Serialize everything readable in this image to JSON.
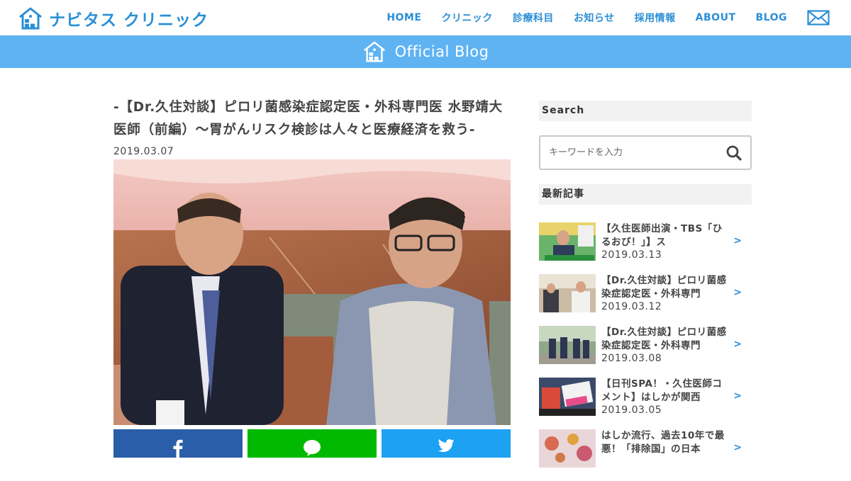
{
  "header": {
    "logo_text": "ナビタス クリニック",
    "nav": [
      "HOME",
      "クリニック",
      "診療科目",
      "お知らせ",
      "採用情報",
      "ABOUT",
      "BLOG"
    ],
    "mail_icon": "mail-icon"
  },
  "blogbar": {
    "title": "Official Blog"
  },
  "article": {
    "title": "-【Dr.久住対談】ピロリ菌感染症認定医・外科専門医 水野靖大医師（前編）～胃がんリスク検診は人々と医療経済を救う-",
    "date": "2019.03.07",
    "share": [
      "facebook-icon",
      "line-icon",
      "twitter-icon"
    ]
  },
  "sidebar": {
    "search_heading": "Search",
    "search_placeholder": "キーワードを入力",
    "recent_heading": "最新記事",
    "recent": [
      {
        "title": "【久住医師出演・TBS「ひるおび！」】ス",
        "date": "2019.03.13",
        "arrow": ">"
      },
      {
        "title": "【Dr.久住対談】ピロリ菌感染症認定医・外科専門",
        "date": "2019.03.12",
        "arrow": ">"
      },
      {
        "title": "【Dr.久住対談】ピロリ菌感染症認定医・外科専門",
        "date": "2019.03.08",
        "arrow": ">"
      },
      {
        "title": "【日刊SPA！・久住医師コメント】はしかが関西",
        "date": "2019.03.05",
        "arrow": ">"
      },
      {
        "title": "はしか流行、過去10年で最悪！「排除国」の日本",
        "date": "",
        "arrow": ">"
      }
    ]
  },
  "colors": {
    "brand_blue": "#2b8fd6",
    "blogbar_blue": "#5fb3f3",
    "facebook": "#2b5ea8",
    "line": "#00b900",
    "twitter": "#1da1f2"
  }
}
